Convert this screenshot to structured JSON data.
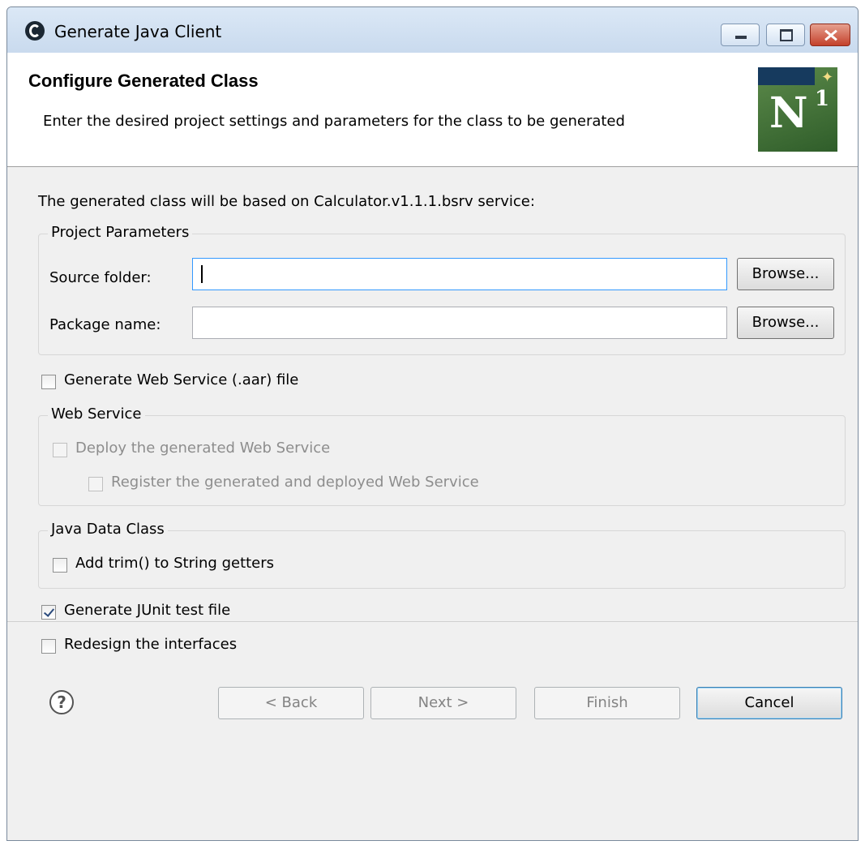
{
  "window": {
    "title": "Generate Java Client"
  },
  "header": {
    "title": "Configure Generated Class",
    "description": "Enter the desired project settings and parameters for the class to be generated",
    "logo_text": "N",
    "logo_sup": "1"
  },
  "intro": "The generated class will be based on Calculator.v1.1.1.bsrv service:",
  "project_parameters": {
    "legend": "Project Parameters",
    "source_folder": {
      "label": "Source folder:",
      "value": "",
      "browse_label": "Browse..."
    },
    "package_name": {
      "label": "Package name:",
      "value": "",
      "browse_label": "Browse..."
    }
  },
  "generate_web_service": {
    "label": "Generate Web Service (.aar) file",
    "checked": false
  },
  "web_service": {
    "legend": "Web Service",
    "deploy": {
      "label": "Deploy the generated Web Service",
      "checked": false,
      "enabled": false
    },
    "register": {
      "label": "Register the generated and deployed Web Service",
      "checked": false,
      "enabled": false
    }
  },
  "java_data_class": {
    "legend": "Java Data Class",
    "add_trim": {
      "label": "Add trim() to String getters",
      "checked": false
    }
  },
  "generate_junit": {
    "label": "Generate JUnit test file",
    "checked": true
  },
  "redesign": {
    "label": "Redesign the interfaces",
    "checked": false
  },
  "footer": {
    "help_symbol": "?",
    "back_label": "< Back",
    "next_label": "Next >",
    "finish_label": "Finish",
    "cancel_label": "Cancel"
  }
}
